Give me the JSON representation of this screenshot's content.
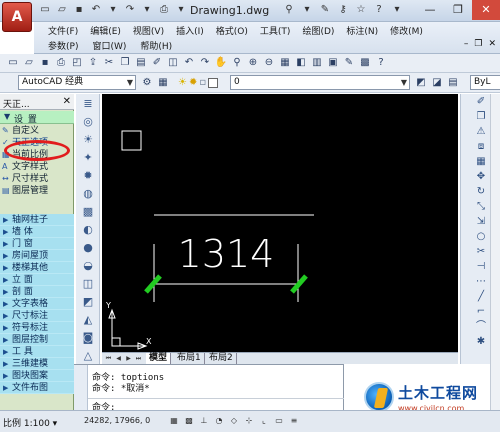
{
  "window": {
    "title": "Drawing1.dwg",
    "app_badge": "A",
    "minimize": "—",
    "maximize": "❐",
    "close": "✕"
  },
  "menu": {
    "row1": [
      "文件(F)",
      "编辑(E)",
      "视图(V)",
      "插入(I)",
      "格式(O)",
      "工具(T)",
      "绘图(D)",
      "标注(N)",
      "修改(M)"
    ],
    "row2": [
      "参数(P)",
      "窗口(W)",
      "帮助(H)"
    ],
    "mdi": [
      "–",
      "❐",
      "✕"
    ]
  },
  "toolbar2": {
    "workspace": "AutoCAD 经典",
    "layer": "0",
    "bylayer": "ByL"
  },
  "tz_panel": {
    "title": "天正...",
    "close": "✕",
    "section": "设  置",
    "section_arrow": "▼",
    "items": [
      "自定义",
      "天正选项",
      "当前比例",
      "文字样式",
      "尺寸样式",
      "图层管理"
    ],
    "categories": [
      "轴网柱子",
      "墙  体",
      "门  窗",
      "房间屋顶",
      "楼梯其他",
      "立  面",
      "剖  面",
      "文字表格",
      "尺寸标注",
      "符号标注",
      "图层控制",
      "工  具",
      "三维建模",
      "图块图案",
      "文件布图"
    ]
  },
  "canvas": {
    "dimension_text": "1314",
    "ucs_x": "X",
    "ucs_y": "Y"
  },
  "tabs": {
    "items": [
      "模型",
      "布局1",
      "布局2"
    ]
  },
  "command": {
    "lines": [
      "命令: toptions",
      "命令: *取消*",
      "命令:"
    ]
  },
  "status": {
    "scale": "比例 1:100 ▾",
    "coords": "24282, 17966, 0"
  },
  "watermark": {
    "name": "土木工程网",
    "url": "www.civilcn.com"
  },
  "colors": {
    "canvas_bg": "#000000",
    "dim_color": "#ffffff",
    "tick_color": "#22cc22",
    "highlight_ellipse": "#e11d1d"
  }
}
